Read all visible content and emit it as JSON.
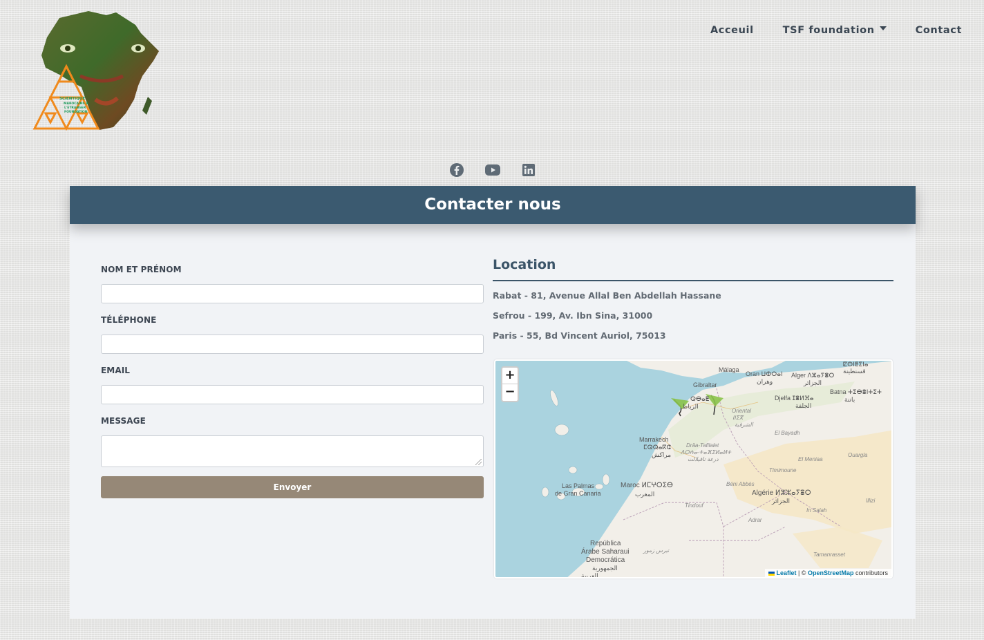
{
  "logo": {
    "text_lines": [
      "SCIENTIQUE",
      "MAROCAINS À",
      "L'ETRANGER",
      "FOUNDATION"
    ]
  },
  "nav": {
    "items": [
      {
        "label": "Acceuil"
      },
      {
        "label": "TSF foundation",
        "has_dropdown": true
      },
      {
        "label": "Contact"
      }
    ]
  },
  "social": {
    "icons": [
      "facebook-icon",
      "youtube-icon",
      "linkedin-icon"
    ]
  },
  "page": {
    "title": "Contacter nous"
  },
  "form": {
    "name_label": "NOM ET PRÉNOM",
    "phone_label": "TÉLÉPHONE",
    "email_label": "EMAIL",
    "message_label": "MESSAGE",
    "name_value": "",
    "phone_value": "",
    "email_value": "",
    "message_value": "",
    "submit_label": "Envoyer"
  },
  "location": {
    "title": "Location",
    "addresses": [
      "Rabat - 81, Avenue Allal Ben Abdellah Hassane",
      "Sefrou - 199, Av. Ibn Sina, 31000",
      "Paris - 55, Bd Vincent Auriol, 75013"
    ]
  },
  "map": {
    "zoom_in": "+",
    "zoom_out": "−",
    "attribution": {
      "leaflet": "Leaflet",
      "sep": " | © ",
      "osm": "OpenStreetMap",
      "suffix": " contributors"
    },
    "labels": [
      "Málaga",
      "Gibraltar",
      "Oran ⵡⵀⵔⴰⵏ",
      "وهران",
      "Alger ⴷⵣⴰⵢⴻⵔ",
      "الجزائر",
      "ⵇⵙⵏⵟⵉⵏⴰ",
      "قسنطينة",
      "Batna ⵜⵉⴱⴻⵏⵜⵉⵜ",
      "باتنة",
      "Djelfa ⵊⴻⵍⴼⴰ",
      "الجلفة",
      "ⵕⴱⴰⵟ",
      "الرباط",
      "Oriental",
      "ⵏⵏⵉⴳ",
      "الشرقية",
      "Marrakech",
      "ⵎⵕⵕⴰⴽⵛ",
      "مراكش",
      "Drâa-Tafilalet",
      "ⴷⵔⵄⴰ-ⵜⴰⴼⵉⵍⴰⵍⵜ",
      "درعة تافيلالت",
      "El Bayadh",
      "El Meniaa",
      "Ouargla",
      "Timimoune",
      "Béni Abbès",
      "Algérie ⵍⵣⵣⴰⵢⴻⵔ",
      "الجزائر",
      "Tindouf",
      "Adrar",
      "In Salah",
      "Illizi",
      "Tamanrasset",
      "Las Palmas",
      "de Gran Canaria",
      "Maroc ⵍⵎⵖⵔⵉⴱ",
      "المغرب",
      "República",
      "Árabe Saharaui",
      "Democrática",
      "الجمهورية",
      "تيرس زمور",
      "العربية"
    ]
  },
  "colors": {
    "band": "#3b5a70",
    "submit": "#968877",
    "panel": "#f1f3f6",
    "text": "#3d4652",
    "sea": "#aad3df",
    "land": "#f2efe9"
  }
}
